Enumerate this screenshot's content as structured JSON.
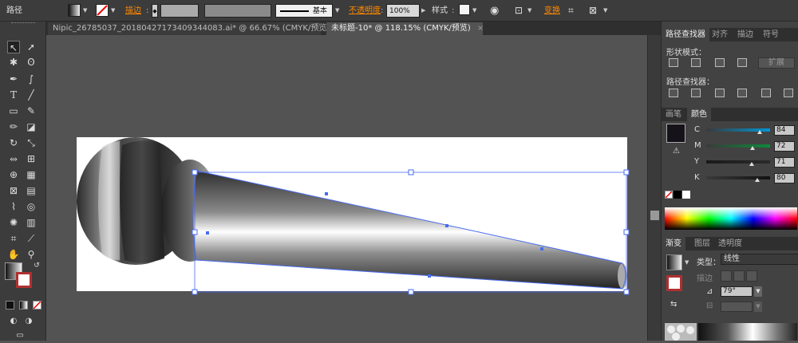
{
  "topbar": {
    "selection_label": "路径",
    "stroke_label": "描边",
    "stroke_style": "基本",
    "opacity_label": "不透明度",
    "opacity_value": "100%",
    "style_label": "样式",
    "transform_label": "变换"
  },
  "tabs": [
    {
      "label": "Nipic_26785037_20180427173409344083.ai* @ 66.67% (CMYK/预览)",
      "close": "×"
    },
    {
      "label": "未标题-10* @ 118.15% (CMYK/预览)",
      "close": "×"
    }
  ],
  "pathfinder": {
    "tabs": [
      "路径查找器",
      "对齐",
      "描边",
      "符号"
    ],
    "shape_modes_label": "形状模式：",
    "expand_label": "扩展",
    "pathfinders_label": "路径查找器："
  },
  "color": {
    "tabs": [
      "画笔",
      "颜色"
    ],
    "channels": [
      {
        "label": "C",
        "value": "84",
        "level": 0.84,
        "gradient": "linear-gradient(90deg,#3a3a3a,#0096d6)"
      },
      {
        "label": "M",
        "value": "72",
        "level": 0.72,
        "gradient": "linear-gradient(90deg,#3a3a3a,#0b8a3a)"
      },
      {
        "label": "Y",
        "value": "71",
        "level": 0.71,
        "gradient": "linear-gradient(90deg,#1a1a1a,#2a2a2a)"
      },
      {
        "label": "K",
        "value": "80",
        "level": 0.8,
        "gradient": "linear-gradient(90deg,#3a3a3a,#111)"
      }
    ],
    "fill_color": "#15121a"
  },
  "gradient": {
    "tabs": [
      "渐变",
      "图层",
      "透明度"
    ],
    "type_label": "类型：",
    "type_value": "线性",
    "stroke_label": "描边",
    "angle_value": "79°"
  },
  "colors": {
    "panel_bg": "#424242",
    "accent_orange": "#ff8a00",
    "selection_blue": "#4a6cf0"
  }
}
